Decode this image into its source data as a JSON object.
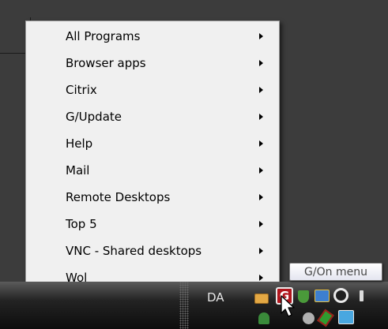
{
  "menu": {
    "items": [
      {
        "label": "All Programs"
      },
      {
        "label": "Browser apps"
      },
      {
        "label": "Citrix"
      },
      {
        "label": "G/Update"
      },
      {
        "label": "Help"
      },
      {
        "label": "Mail"
      },
      {
        "label": "Remote Desktops"
      },
      {
        "label": "Top 5"
      },
      {
        "label": "VNC - Shared desktops"
      },
      {
        "label": "Wol"
      }
    ]
  },
  "taskbar": {
    "language_indicator": "DA",
    "gon_icon_letter": "G",
    "tray_icons": [
      "mail-icon",
      "g-on-icon",
      "shield-check-icon",
      "network-icon",
      "circle-icon",
      "speaker-icon",
      "user-status-icon",
      "gear-icon",
      "green-tag-icon",
      "monitor-icon"
    ]
  },
  "tooltip": {
    "text": "G/On menu"
  },
  "colors": {
    "desktop_bg": "#3c3c3c",
    "menu_bg": "#f0f0f0",
    "gon_icon_red": "#b0161d"
  }
}
